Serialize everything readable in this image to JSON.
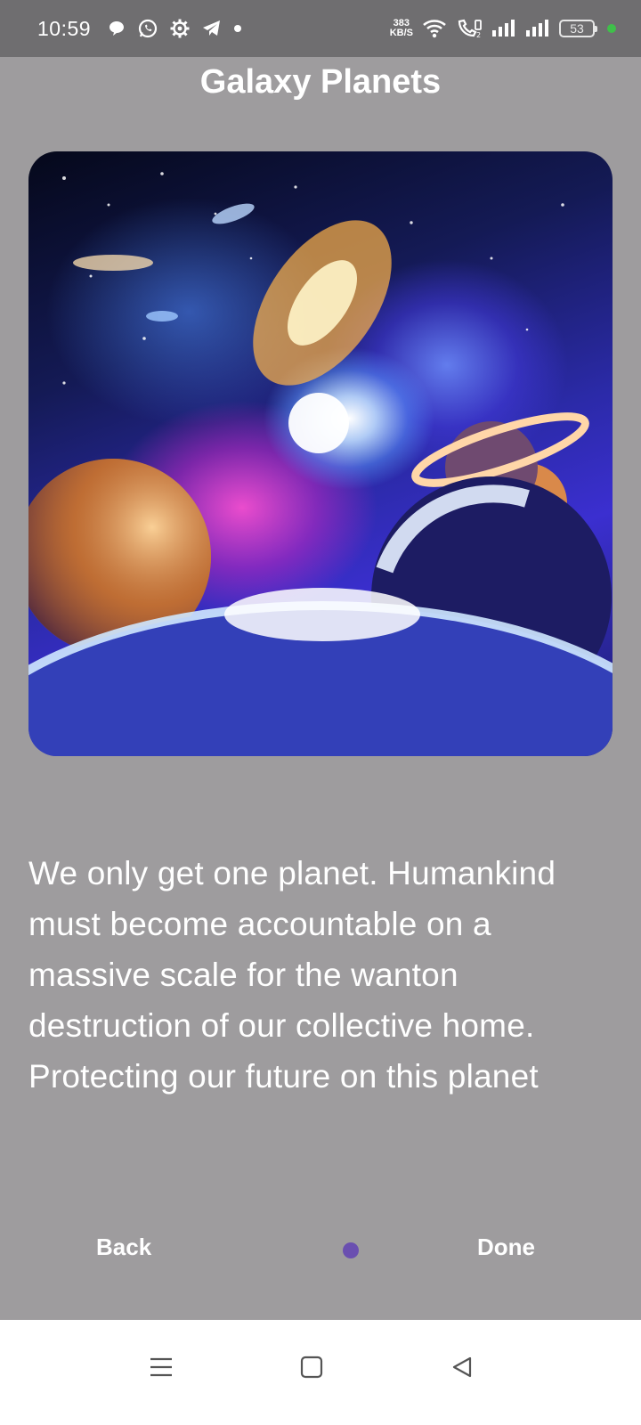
{
  "status_bar": {
    "time": "10:59",
    "net_speed_value": "383",
    "net_speed_unit": "KB/S",
    "battery_level": "53",
    "left_icons": [
      "chat-bubble-icon",
      "whatsapp-icon",
      "settings-gear-icon",
      "telegram-icon",
      "dot-icon"
    ],
    "right_icons": [
      "wifi-icon",
      "volte-call-icon",
      "signal-bars-icon",
      "signal-bars-icon"
    ]
  },
  "page": {
    "title": "Galaxy Planets",
    "image_alt": "galaxy with planets illustration",
    "quote": "We only get one planet. Humankind must become accountable on a massive scale for the wanton destruction of our collective home. Protecting our future on this planet"
  },
  "onboarding_nav": {
    "back_label": "Back",
    "done_label": "Done",
    "indicator": {
      "total_visible": 1,
      "active_index": 0,
      "active_color": "#6a4fb0"
    }
  },
  "system_nav": {
    "icons": [
      "menu-icon",
      "home-icon",
      "back-triangle-icon"
    ]
  },
  "colors": {
    "background": "#9e9c9e",
    "status_bar": "#6f6e70",
    "text": "#ffffff",
    "system_nav": "#ffffff"
  }
}
